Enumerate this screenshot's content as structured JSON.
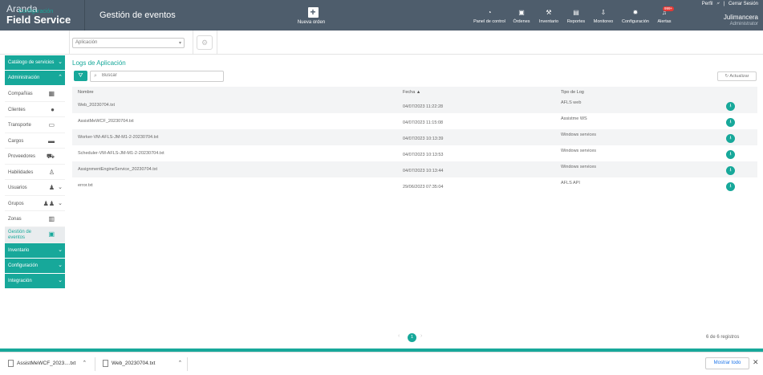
{
  "header": {
    "brand_line1": "Aranda",
    "brand_line2": "Field Service",
    "title": "Gestión de eventos",
    "new_order": "Nueva orden",
    "nav": [
      {
        "label": "Panel de control",
        "icon": "dashboard-icon"
      },
      {
        "label": "Órdenes",
        "icon": "orders-icon"
      },
      {
        "label": "Inventario",
        "icon": "inventory-icon"
      },
      {
        "label": "Reportes",
        "icon": "reports-icon"
      },
      {
        "label": "Monitoreo",
        "icon": "monitor-icon"
      },
      {
        "label": "Configuración",
        "icon": "gear-icon"
      },
      {
        "label": "Alertas",
        "icon": "bell-icon"
      }
    ],
    "alert_badge": "999+",
    "profile": "Perfil",
    "logout": "Cerrar Sesión",
    "user_name": "Julimancera",
    "user_role": "Administrator"
  },
  "subbar": {
    "config_label": "Configuración",
    "select_value": "Aplicación"
  },
  "sidebar": {
    "catalog": "Catálogo de servicios",
    "admin": "Administración",
    "items": [
      {
        "label": "Compañías",
        "icon": "building-icon"
      },
      {
        "label": "Clientes",
        "icon": "person-icon"
      },
      {
        "label": "Transporte",
        "icon": "bus-icon"
      },
      {
        "label": "Cargos",
        "icon": "briefcase-icon"
      },
      {
        "label": "Proveedores",
        "icon": "truck-icon"
      },
      {
        "label": "Habilidades",
        "icon": "skill-icon"
      },
      {
        "label": "Usuarios",
        "icon": "user-icon"
      },
      {
        "label": "Grupos",
        "icon": "group-icon"
      },
      {
        "label": "Zonas",
        "icon": "zone-icon"
      },
      {
        "label": "Gestión de eventos",
        "icon": "events-icon"
      }
    ],
    "inventory": "Inventario",
    "configuration": "Configuración",
    "integration": "Integración"
  },
  "main": {
    "title": "Logs de Aplicación",
    "search_placeholder": "Buscar",
    "refresh": "Actualizar",
    "columns": {
      "name": "Nombre",
      "date": "Fecha",
      "type": "Tipo de Log"
    },
    "rows": [
      {
        "name": "Web_20230704.txt",
        "date": "04/07/2023 11:22:28",
        "type": "AFLS web"
      },
      {
        "name": "AssistMeWCF_20230704.txt",
        "date": "04/07/2023 11:15:08",
        "type": "Assistme WS"
      },
      {
        "name": "Worker-VM-AFLS-JM-M1-2-20230704.txt",
        "date": "04/07/2023 10:13:39",
        "type": "Windows services"
      },
      {
        "name": "Scheduler-VM-AFLS-JM-M1-2-20230704.txt",
        "date": "04/07/2023 10:13:53",
        "type": "Windows services"
      },
      {
        "name": "AssignmentEngineService_20230704.txt",
        "date": "04/07/2023 10:13:44",
        "type": "Windows services"
      },
      {
        "name": "error.txt",
        "date": "29/06/2023 07:35:04",
        "type": "AFLS API"
      }
    ],
    "page": "1",
    "records": "6 de 6 registros"
  },
  "downloads": {
    "items": [
      "AssistMeWCF_2023....txt",
      "Web_20230704.txt"
    ],
    "show_all": "Mostrar todo"
  }
}
